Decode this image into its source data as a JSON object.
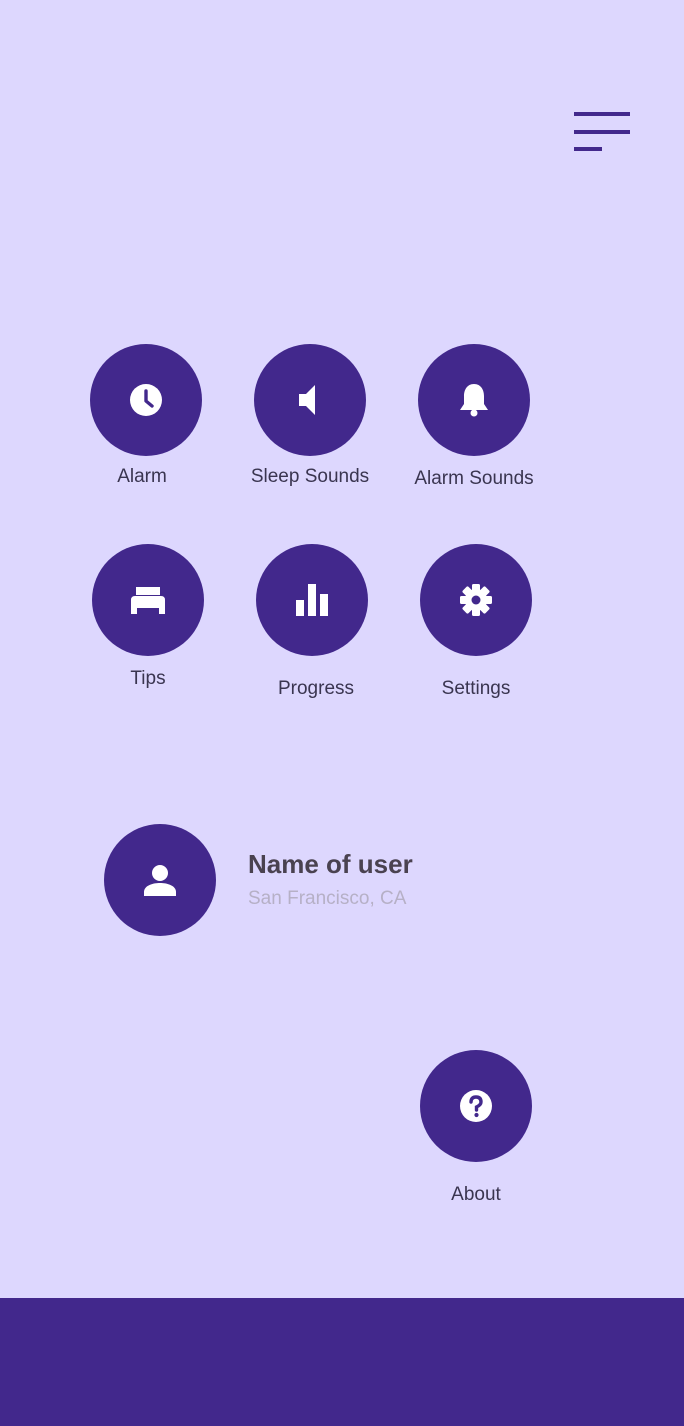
{
  "colors": {
    "background": "#DDD7FE",
    "accent": "#42288C",
    "icon": "#FFFFFF",
    "label": "#3a3550",
    "secondary_text": "#b6b0c6"
  },
  "header": {
    "menu_icon": "hamburger-menu-icon"
  },
  "menu": {
    "alarm": {
      "label": "Alarm",
      "icon": "clock-icon"
    },
    "sleep_sounds": {
      "label": "Sleep Sounds",
      "icon": "speaker-icon"
    },
    "alarm_sounds": {
      "label": "Alarm Sounds",
      "icon": "bell-icon"
    },
    "tips": {
      "label": "Tips",
      "icon": "bed-icon"
    },
    "progress": {
      "label": "Progress",
      "icon": "bar-chart-icon"
    },
    "settings": {
      "label": "Settings",
      "icon": "gear-icon"
    }
  },
  "user": {
    "name": "Name of user",
    "location": "San Francisco, CA",
    "avatar_icon": "person-icon"
  },
  "about": {
    "label": "About",
    "icon": "question-icon"
  }
}
